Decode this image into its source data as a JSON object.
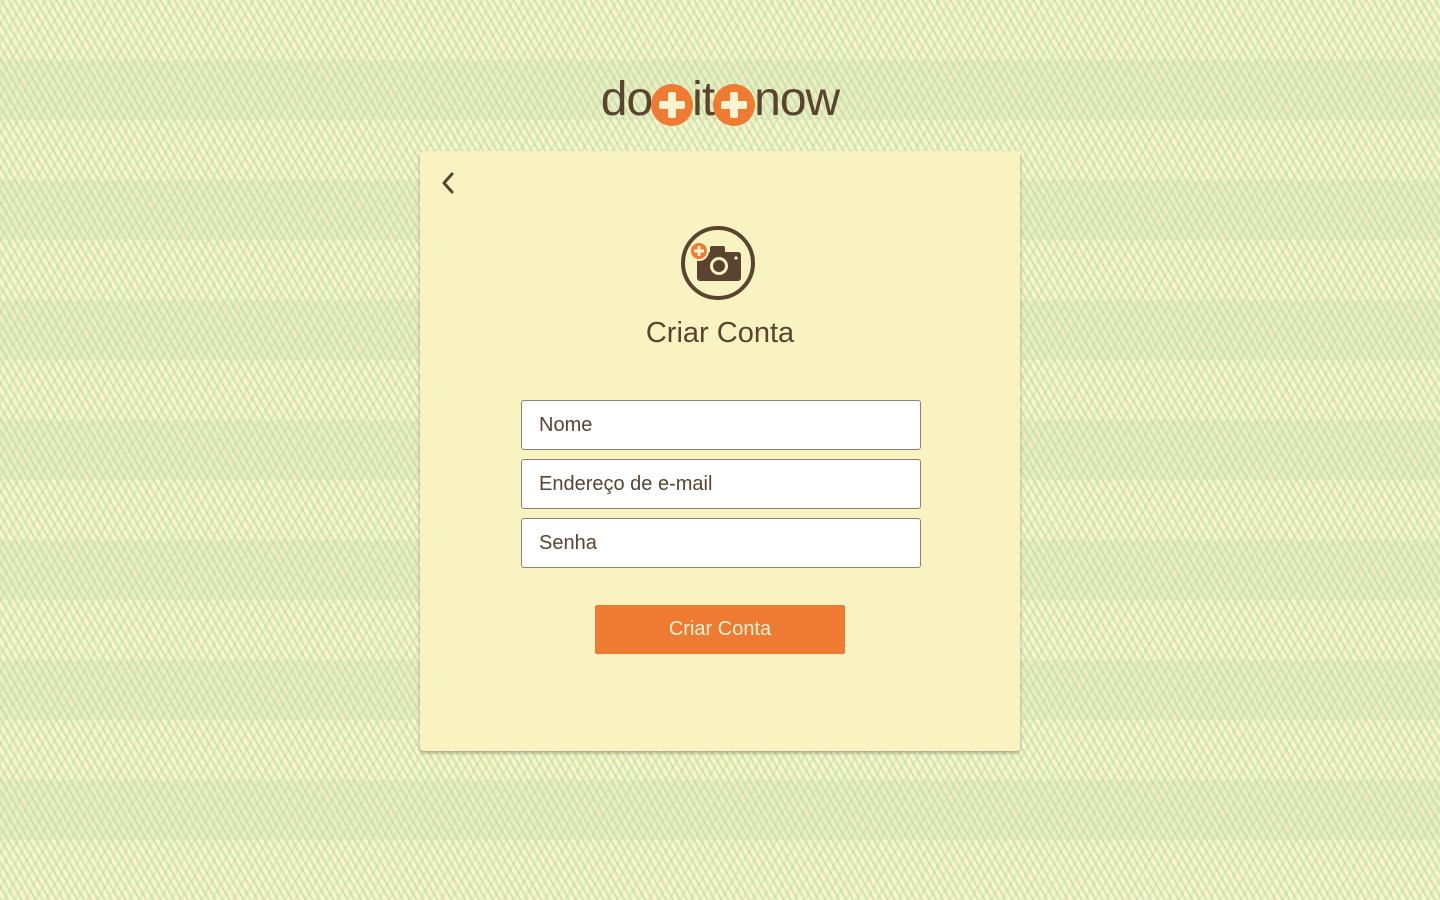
{
  "logo": {
    "word1": "do",
    "word2": "it",
    "word3": "now"
  },
  "card": {
    "back_icon": "chevron-left-icon",
    "avatar_icon": "add-photo-camera-icon",
    "title": "Criar Conta",
    "fields": {
      "name_placeholder": "Nome",
      "email_placeholder": "Endereço de e-mail",
      "password_placeholder": "Senha"
    },
    "submit_label": "Criar Conta"
  },
  "colors": {
    "accent": "#ef7a32",
    "text": "#5a4430",
    "card_bg": "#f9f2c1",
    "page_bg": "#f5f1c0"
  }
}
